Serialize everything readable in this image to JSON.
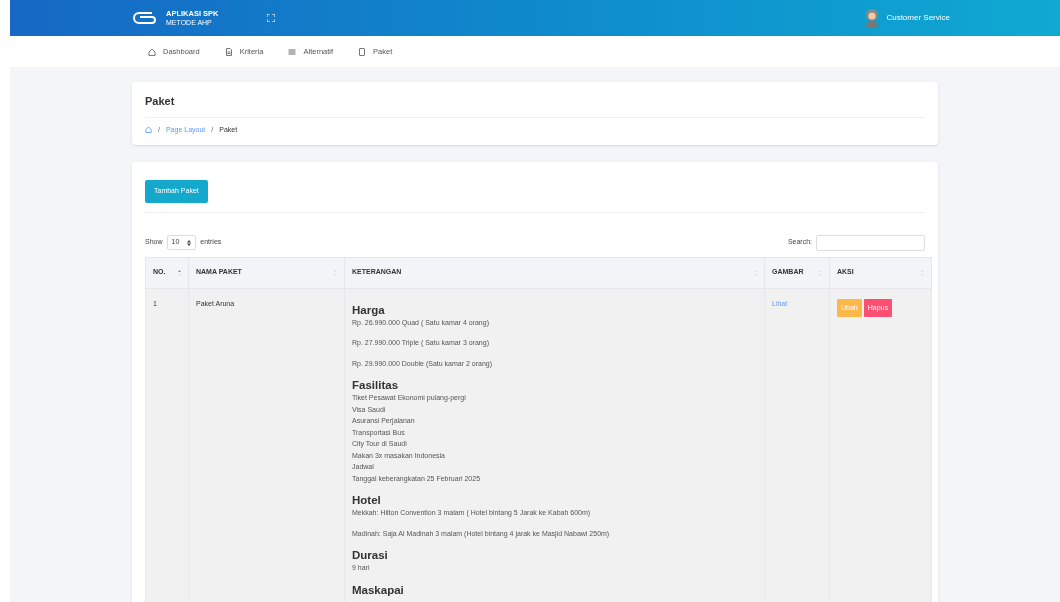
{
  "header": {
    "logo_line1": "APLIKASI SPK",
    "logo_line2": "METODE AHP",
    "user": "Customer Service"
  },
  "nav": [
    {
      "label": "Dashboard"
    },
    {
      "label": "Kriteria"
    },
    {
      "label": "Alternatif"
    },
    {
      "label": "Paket"
    }
  ],
  "page_title": "Paket",
  "breadcrumb": [
    {
      "label": "/",
      "kind": "separator"
    },
    {
      "label": "Page Layout",
      "kind": "link"
    },
    {
      "label": "/",
      "kind": "separator"
    },
    {
      "label": "Paket",
      "kind": "current"
    }
  ],
  "add_button": "Tambah Paket",
  "length": {
    "show": "Show",
    "value": "10",
    "entries": "entries"
  },
  "search": {
    "label": "Search:"
  },
  "table": {
    "columns": [
      {
        "label": "NO.",
        "sorted": true
      },
      {
        "label": "NAMA PAKET",
        "sorted": false
      },
      {
        "label": "KETERANGAN",
        "sorted": false
      },
      {
        "label": "GAMBAR",
        "sorted": false
      },
      {
        "label": "AKSI",
        "sorted": false
      }
    ],
    "rows": [
      {
        "no": "1",
        "nama": "Paket Aruna",
        "gambar": "Lihat",
        "actions": [
          {
            "label": "Ubah",
            "kind": "edit"
          },
          {
            "label": "Hapus",
            "kind": "delete"
          }
        ],
        "keterangan": [
          {
            "heading": "Harga",
            "paragraphs": [
              [
                "Rp. 26.990.000 Quad ( Satu kamar 4 orang)"
              ],
              [
                "Rp. 27.990.000 Triple ( Satu kamar 3 orang)"
              ],
              [
                "Rp. 29.990.000 Double (Satu kamar 2 orang)"
              ]
            ]
          },
          {
            "heading": "Fasilitas",
            "paragraphs": [
              [
                "Tiket Pesawat Ekonomi pulang-pergi",
                "Visa Saudi",
                "Asuransi Perjalanan",
                "Transportasi Bus",
                "City Tour di Saudi",
                "Makan 3x masakan Indonesia",
                "Jadwal",
                "Tanggal keberangkatan 25 Februari 2025"
              ]
            ]
          },
          {
            "heading": "Hotel",
            "paragraphs": [
              [
                "Mekkah: Hilton Convention 3 malam ( Hotel bintang 5 Jarak ke Kabah 600m)"
              ],
              [
                "Madinah: Saja Al Madinah 3 malam (Hotel bintang 4 jarak ke Masjid Nabawi 250m)"
              ]
            ]
          },
          {
            "heading": "Durasi",
            "paragraphs": [
              [
                "9 hari"
              ]
            ]
          },
          {
            "heading": "Maskapai"
          }
        ]
      }
    ]
  }
}
